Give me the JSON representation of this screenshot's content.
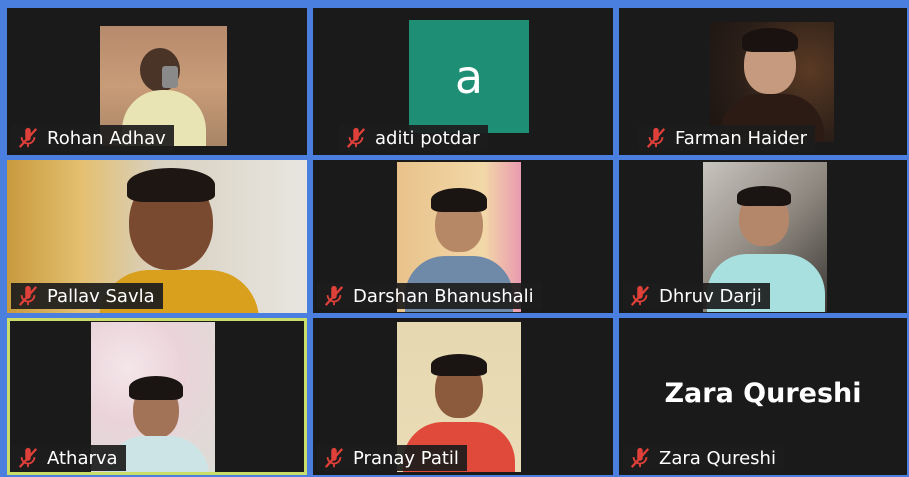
{
  "participants": [
    {
      "name": "Rohan Adhav",
      "video": true,
      "muted": true
    },
    {
      "name": "aditi potdar",
      "video": false,
      "avatar_letter": "a",
      "avatar_color": "#1e8f74",
      "muted": true
    },
    {
      "name": "Farman Haider",
      "video": true,
      "muted": true
    },
    {
      "name": "Pallav Savla",
      "video": true,
      "muted": true
    },
    {
      "name": "Darshan Bhanushali",
      "video": true,
      "muted": true
    },
    {
      "name": "Dhruv Darji",
      "video": true,
      "muted": true
    },
    {
      "name": "Atharva",
      "video": true,
      "muted": true,
      "active_speaker": true
    },
    {
      "name": "Pranay Patil",
      "video": true,
      "muted": true
    },
    {
      "name": "Zara Qureshi",
      "video": false,
      "muted": true
    }
  ],
  "colors": {
    "background": "#4a7fe0",
    "tile": "#1a1a1a",
    "active_border": "#c9de6a",
    "muted_icon": "#e0403a"
  },
  "icons": {
    "muted": "mic-off-icon"
  }
}
